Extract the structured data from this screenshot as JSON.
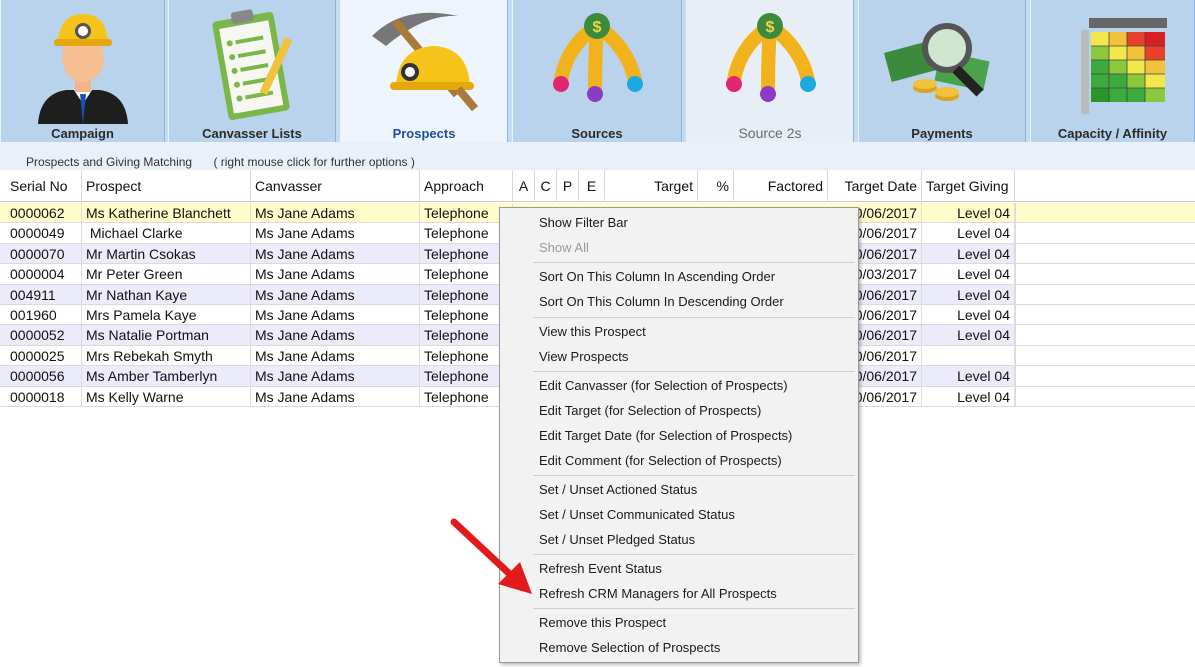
{
  "tabs": [
    {
      "label": "Campaign",
      "icon": "miner-person-icon"
    },
    {
      "label": "Canvasser Lists",
      "icon": "clipboard-icon"
    },
    {
      "label": "Prospects",
      "icon": "pickaxe-helmet-icon"
    },
    {
      "label": "Sources",
      "icon": "money-fountain-icon"
    },
    {
      "label": "Source 2s",
      "icon": "money-fountain-icon"
    },
    {
      "label": "Payments",
      "icon": "money-magnifier-icon"
    },
    {
      "label": "Capacity / Affinity",
      "icon": "heatmap-grid-icon"
    }
  ],
  "section": {
    "title": "Prospects and Giving Matching",
    "hint": "(    right mouse click for further options    )"
  },
  "columns": [
    "Serial No",
    "Prospect",
    "Canvasser",
    "Approach",
    "A",
    "C",
    "P",
    "E",
    "Target",
    "%",
    "Factored",
    "Target Date",
    "Target Giving"
  ],
  "rows": [
    {
      "serial": "0000062",
      "prospect": "Ms Katherine Blanchett",
      "canvasser": "Ms Jane Adams",
      "approach": "Telephone",
      "target_date": "0/06/2017",
      "giving": "Level 04"
    },
    {
      "serial": "0000049",
      "prospect": " Michael Clarke",
      "canvasser": "Ms Jane Adams",
      "approach": "Telephone",
      "target_date": "0/06/2017",
      "giving": "Level 04"
    },
    {
      "serial": "0000070",
      "prospect": "Mr Martin Csokas",
      "canvasser": "Ms Jane Adams",
      "approach": "Telephone",
      "target_date": "0/06/2017",
      "giving": "Level 04"
    },
    {
      "serial": "0000004",
      "prospect": "Mr Peter Green",
      "canvasser": "Ms Jane Adams",
      "approach": "Telephone",
      "target_date": "0/03/2017",
      "giving": "Level 04"
    },
    {
      "serial": "004911",
      "prospect": "Mr Nathan Kaye",
      "canvasser": "Ms Jane Adams",
      "approach": "Telephone",
      "target_date": "0/06/2017",
      "giving": "Level 04"
    },
    {
      "serial": "001960",
      "prospect": "Mrs Pamela Kaye",
      "canvasser": "Ms Jane Adams",
      "approach": "Telephone",
      "target_date": "0/06/2017",
      "giving": "Level 04"
    },
    {
      "serial": "0000052",
      "prospect": "Ms Natalie Portman",
      "canvasser": "Ms Jane Adams",
      "approach": "Telephone",
      "target_date": "0/06/2017",
      "giving": "Level 04"
    },
    {
      "serial": "0000025",
      "prospect": "Mrs Rebekah Smyth",
      "canvasser": "Ms Jane Adams",
      "approach": "Telephone",
      "target_date": "0/06/2017",
      "giving": ""
    },
    {
      "serial": "0000056",
      "prospect": "Ms Amber Tamberlyn",
      "canvasser": "Ms Jane Adams",
      "approach": "Telephone",
      "target_date": "0/06/2017",
      "giving": "Level 04"
    },
    {
      "serial": "0000018",
      "prospect": "Ms Kelly Warne",
      "canvasser": "Ms Jane Adams",
      "approach": "Telephone",
      "target_date": "0/06/2017",
      "giving": "Level 04"
    }
  ],
  "context_menu": {
    "groups": [
      [
        {
          "label": "Show Filter Bar",
          "enabled": true
        },
        {
          "label": "Show All",
          "enabled": false
        }
      ],
      [
        {
          "label": "Sort On This Column In Ascending Order",
          "enabled": true
        },
        {
          "label": "Sort On This Column In Descending Order",
          "enabled": true
        }
      ],
      [
        {
          "label": "View this Prospect",
          "enabled": true
        },
        {
          "label": "View Prospects",
          "enabled": true
        }
      ],
      [
        {
          "label": "Edit Canvasser (for Selection of Prospects)",
          "enabled": true
        },
        {
          "label": "Edit Target (for Selection of Prospects)",
          "enabled": true
        },
        {
          "label": "Edit Target Date (for Selection of Prospects)",
          "enabled": true
        },
        {
          "label": "Edit Comment (for Selection of Prospects)",
          "enabled": true
        }
      ],
      [
        {
          "label": "Set / Unset Actioned Status",
          "enabled": true
        },
        {
          "label": "Set / Unset Communicated Status",
          "enabled": true
        },
        {
          "label": "Set / Unset Pledged Status",
          "enabled": true
        }
      ],
      [
        {
          "label": "Refresh Event Status",
          "enabled": true
        },
        {
          "label": "Refresh CRM Managers for All Prospects",
          "enabled": true
        }
      ],
      [
        {
          "label": "Remove this Prospect",
          "enabled": true
        },
        {
          "label": "Remove Selection of Prospects",
          "enabled": true
        }
      ]
    ]
  },
  "colors": {
    "accent_arrow": "#e11b1b",
    "selected_row": "#fefcc8",
    "alt_row": "#ebebfa",
    "tab_bg": "#b9d3ec",
    "active_tab_text": "#1f4e9a"
  }
}
